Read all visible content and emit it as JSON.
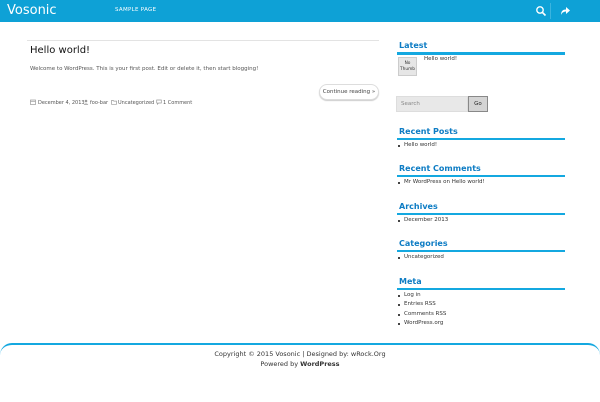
{
  "site": {
    "title": "Vosonic",
    "nav": [
      "SAMPLE PAGE"
    ]
  },
  "post": {
    "title": "Hello world!",
    "excerpt": "Welcome to WordPress. This is your first post. Edit or delete it, then start blogging!",
    "continue_label": "Continue reading »",
    "date": "December 4, 2013",
    "author": "foo-bar",
    "category": "Uncategorized",
    "comments": "1 Comment"
  },
  "sidebar": {
    "latest": {
      "title": "Latest",
      "thumb_text": "No Thumb",
      "link": "Hello world!"
    },
    "search": {
      "placeholder": "Search",
      "button": "Go"
    },
    "recent_posts": {
      "title": "Recent Posts",
      "items": [
        "Hello world!"
      ]
    },
    "recent_comments": {
      "title": "Recent Comments",
      "items": [
        "Mr WordPress on Hello world!"
      ]
    },
    "archives": {
      "title": "Archives",
      "items": [
        "December 2013"
      ]
    },
    "categories": {
      "title": "Categories",
      "items": [
        "Uncategorized"
      ]
    },
    "meta": {
      "title": "Meta",
      "items": [
        "Log in",
        "Entries RSS",
        "Comments RSS",
        "WordPress.org"
      ]
    }
  },
  "footer": {
    "copyright": "Copyright © 2015 Vosonic | Designed by: wRock.Org",
    "powered_prefix": "Powered by ",
    "powered_name": "WordPress"
  },
  "colors": {
    "header": "#0ea1d6",
    "accent": "#14a8e0",
    "widget_title": "#0d7cc4"
  },
  "icons": [
    "search-icon",
    "share-icon",
    "calendar-icon",
    "user-icon",
    "folder-icon",
    "comment-icon"
  ]
}
